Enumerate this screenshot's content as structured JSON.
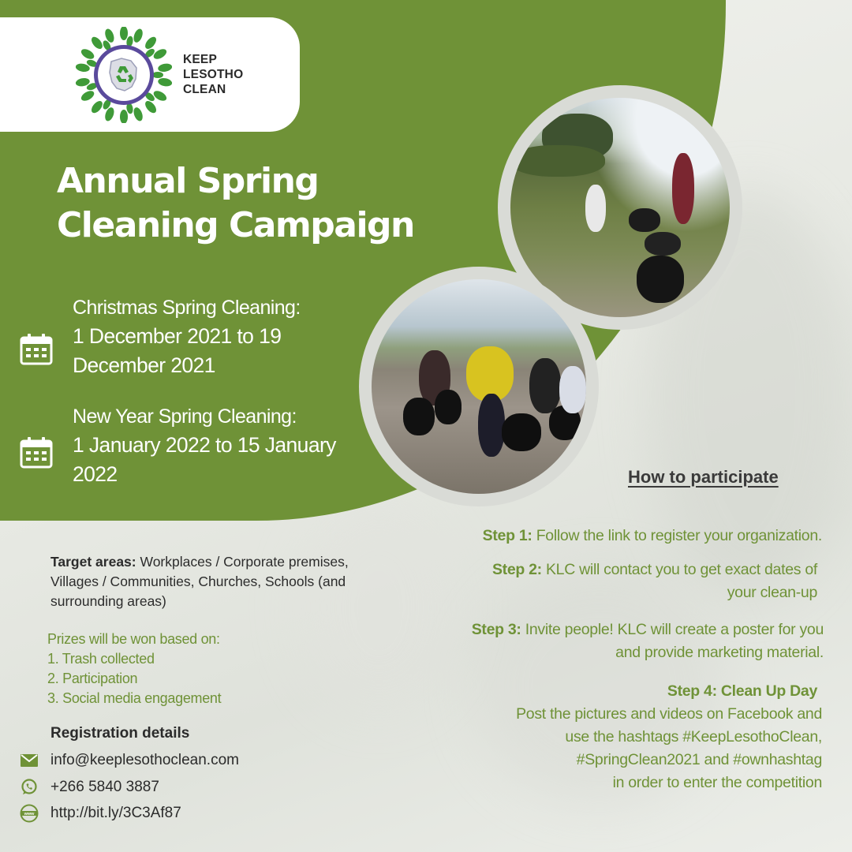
{
  "logo": {
    "line1": "KEEP",
    "line2": "LESOTHO",
    "line3": "CLEAN"
  },
  "title": {
    "line1": "Annual Spring",
    "line2": "Cleaning Campaign"
  },
  "events": [
    {
      "label": "Christmas Spring Cleaning:",
      "dates_line1": "1 December 2021 to 19",
      "dates_line2": "December 2021"
    },
    {
      "label": "New Year Spring Cleaning:",
      "dates_line1": "1 January 2022 to 15 January",
      "dates_line2": "2022"
    }
  ],
  "target": {
    "label": "Target areas:",
    "text": " Workplaces / Corporate premises, Villages / Communities, Churches, Schools (and surrounding areas)"
  },
  "prizes": {
    "heading": "Prizes will be won based on:",
    "items": [
      "1. Trash collected",
      "2. Participation",
      "3. Social media engagement"
    ]
  },
  "registration": {
    "title": "Registration details",
    "email": "info@keeplesothoclean.com",
    "phone": "+266 5840 3887",
    "link": "http://bit.ly/3C3Af87"
  },
  "participate": {
    "heading": "How to participate",
    "step1_label": "Step 1:",
    "step1_text": " Follow the link to register your organization.",
    "step2_label": "Step 2:",
    "step2_text_line1": " KLC will contact you to get exact dates of",
    "step2_text_line2": "your clean-up",
    "step3_label": "Step 3:",
    "step3_text_line1": " Invite people! KLC will create a poster for you",
    "step3_text_line2": "and provide marketing material.",
    "step4_label": "Step 4: Clean Up Day",
    "step4_line1": "Post the pictures and videos on Facebook and",
    "step4_line2": "use the hashtags #KeepLesothoClean,",
    "step4_line3": "#SpringClean2021 and #ownhashtag",
    "step4_line4": "in order to enter the competition"
  },
  "colors": {
    "brand_green": "#6f9237",
    "logo_purple": "#5a4a9c",
    "logo_leaf": "#3f9a38"
  },
  "icons": [
    "calendar-icon",
    "mail-icon",
    "whatsapp-icon",
    "web-icon"
  ]
}
